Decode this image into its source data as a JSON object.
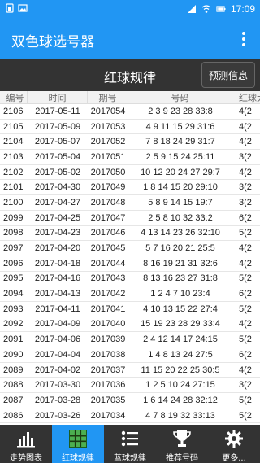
{
  "status_bar": {
    "time": "17:09",
    "icons": [
      "sim-icon",
      "image-icon",
      "network-4g-icon",
      "wifi-icon",
      "battery-icon"
    ]
  },
  "app_bar": {
    "title": "双色球选号器",
    "menu_icon": "more-vert-icon"
  },
  "section": {
    "title": "红球规律",
    "predict_button": "预测信息"
  },
  "table": {
    "headers": [
      "编号",
      "时间",
      "期号",
      "号码",
      "红球大"
    ],
    "rows": [
      [
        "2106",
        "2017-05-11",
        "2017054",
        "2 3 9 23 28 33:8",
        "4(2"
      ],
      [
        "2105",
        "2017-05-09",
        "2017053",
        "4 9 11 15 29 31:6",
        "4(2"
      ],
      [
        "2104",
        "2017-05-07",
        "2017052",
        "7 8 18 24 29 31:7",
        "4(2"
      ],
      [
        "2103",
        "2017-05-04",
        "2017051",
        "2 5 9 15 24 25:11",
        "3(2"
      ],
      [
        "2102",
        "2017-05-02",
        "2017050",
        "10 12 20 24 27 29:7",
        "4(2"
      ],
      [
        "2101",
        "2017-04-30",
        "2017049",
        "1 8 14 15 20 29:10",
        "3(2"
      ],
      [
        "2100",
        "2017-04-27",
        "2017048",
        "5 8 9 14 15 19:7",
        "3(2"
      ],
      [
        "2099",
        "2017-04-25",
        "2017047",
        "2 5 8 10 32 33:2",
        "6(2"
      ],
      [
        "2098",
        "2017-04-23",
        "2017046",
        "4 13 14 23 26 32:10",
        "5(2"
      ],
      [
        "2097",
        "2017-04-20",
        "2017045",
        "5 7 16 20 21 25:5",
        "4(2"
      ],
      [
        "2096",
        "2017-04-18",
        "2017044",
        "8 16 19 21 31 32:6",
        "4(2"
      ],
      [
        "2095",
        "2017-04-16",
        "2017043",
        "8 13 16 23 27 31:8",
        "5(2"
      ],
      [
        "2094",
        "2017-04-13",
        "2017042",
        "1 2 4 7 10 23:4",
        "6(2"
      ],
      [
        "2093",
        "2017-04-11",
        "2017041",
        "4 10 13 15 22 27:4",
        "5(2"
      ],
      [
        "2092",
        "2017-04-09",
        "2017040",
        "15 19 23 28 29 33:4",
        "4(2"
      ],
      [
        "2091",
        "2017-04-06",
        "2017039",
        "2 4 12 14 17 24:15",
        "5(2"
      ],
      [
        "2090",
        "2017-04-04",
        "2017038",
        "1 4 8 13 24 27:5",
        "6(2"
      ],
      [
        "2089",
        "2017-04-02",
        "2017037",
        "11 15 20 22 25 30:5",
        "4(2"
      ],
      [
        "2088",
        "2017-03-30",
        "2017036",
        "1 2 5 10 24 27:15",
        "3(2"
      ],
      [
        "2087",
        "2017-03-28",
        "2017035",
        "1 6 14 24 28 32:12",
        "5(2"
      ],
      [
        "2086",
        "2017-03-26",
        "2017034",
        "4 7 8 19 32 33:13",
        "5(2"
      ]
    ]
  },
  "bottom_nav": [
    {
      "label": "走势图表",
      "icon": "bar-chart-icon",
      "active": false
    },
    {
      "label": "红球规律",
      "icon": "grid-table-icon",
      "active": true
    },
    {
      "label": "蓝球规律",
      "icon": "list-icon",
      "active": false
    },
    {
      "label": "推荐号码",
      "icon": "trophy-icon",
      "active": false
    },
    {
      "label": "更多...",
      "icon": "gear-icon",
      "active": false
    }
  ],
  "colors": {
    "primary": "#2196f3",
    "dark": "#333333",
    "active_tab": "#2196f3"
  }
}
